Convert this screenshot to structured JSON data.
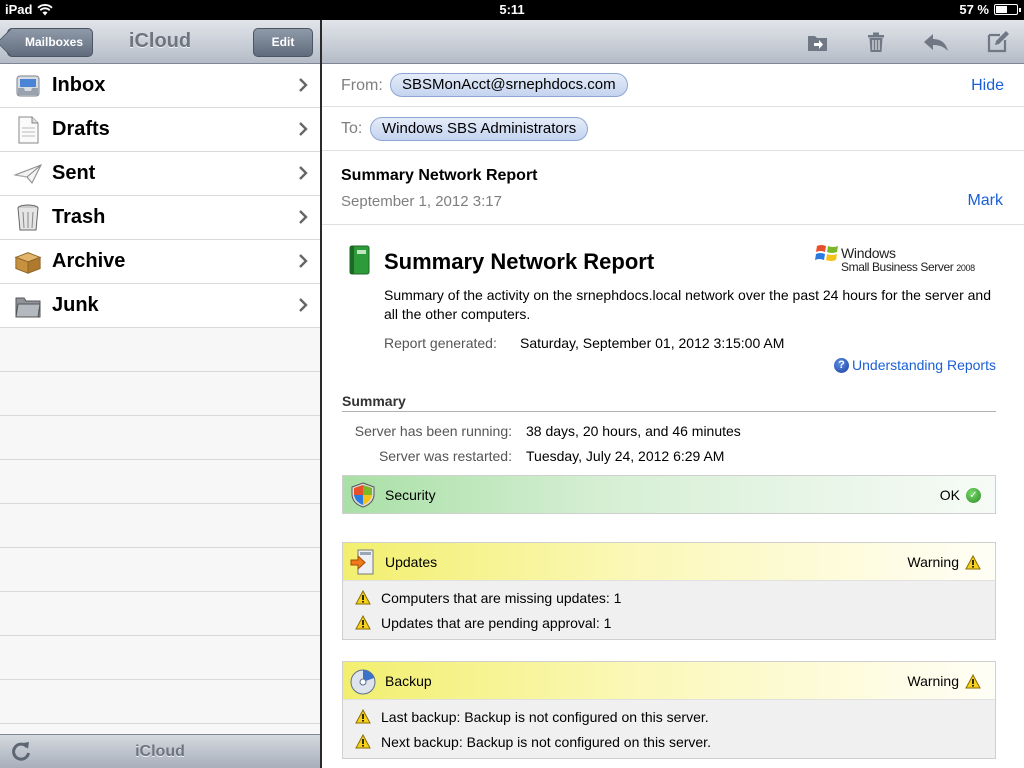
{
  "statusbar": {
    "device": "iPad",
    "time": "5:11",
    "battery": "57 %",
    "battery_level": 0.57
  },
  "mailboxes_pane": {
    "back_label": "Mailboxes",
    "title": "iCloud",
    "edit_label": "Edit",
    "items": [
      {
        "label": "Inbox",
        "icon": "inbox-tray-icon"
      },
      {
        "label": "Drafts",
        "icon": "draft-document-icon"
      },
      {
        "label": "Sent",
        "icon": "paper-plane-icon"
      },
      {
        "label": "Trash",
        "icon": "trash-can-icon"
      },
      {
        "label": "Archive",
        "icon": "archive-box-icon"
      },
      {
        "label": "Junk",
        "icon": "junk-folder-icon"
      }
    ],
    "bottom_title": "iCloud"
  },
  "message": {
    "from_label": "From:",
    "from": "SBSMonAcct@srnephdocs.com",
    "hide_label": "Hide",
    "to_label": "To:",
    "to": "Windows SBS Administrators",
    "subject": "Summary Network Report",
    "date": "September 1, 2012 3:17",
    "mark_label": "Mark"
  },
  "report": {
    "title": "Summary Network Report",
    "logo_line1": "Windows",
    "logo_line2": "Small Business Server",
    "logo_year": "2008",
    "description": "Summary of the activity on the srnephdocs.local network over the past 24 hours for the server and all the other computers.",
    "generated_label": "Report generated:",
    "generated_value": "Saturday, September 01, 2012 3:15:00 AM",
    "understanding_link": "Understanding Reports",
    "summary_heading": "Summary",
    "running_label": "Server has been running:",
    "running_value": "38 days, 20 hours, and 46 minutes",
    "restarted_label": "Server was restarted:",
    "restarted_value": "Tuesday, July 24, 2012 6:29 AM",
    "sections": [
      {
        "name": "Security",
        "status": "OK",
        "items": []
      },
      {
        "name": "Updates",
        "status": "Warning",
        "items": [
          "Computers that are missing updates: 1",
          "Updates that are pending approval: 1"
        ]
      },
      {
        "name": "Backup",
        "status": "Warning",
        "items": [
          "Last backup: Backup is not configured on this server.",
          "Next backup: Backup is not configured on this server."
        ]
      }
    ]
  },
  "colors": {
    "link": "#1a5fd6",
    "ok_green": "#2a8d22",
    "warning_yellow": "#f2ef6f"
  }
}
